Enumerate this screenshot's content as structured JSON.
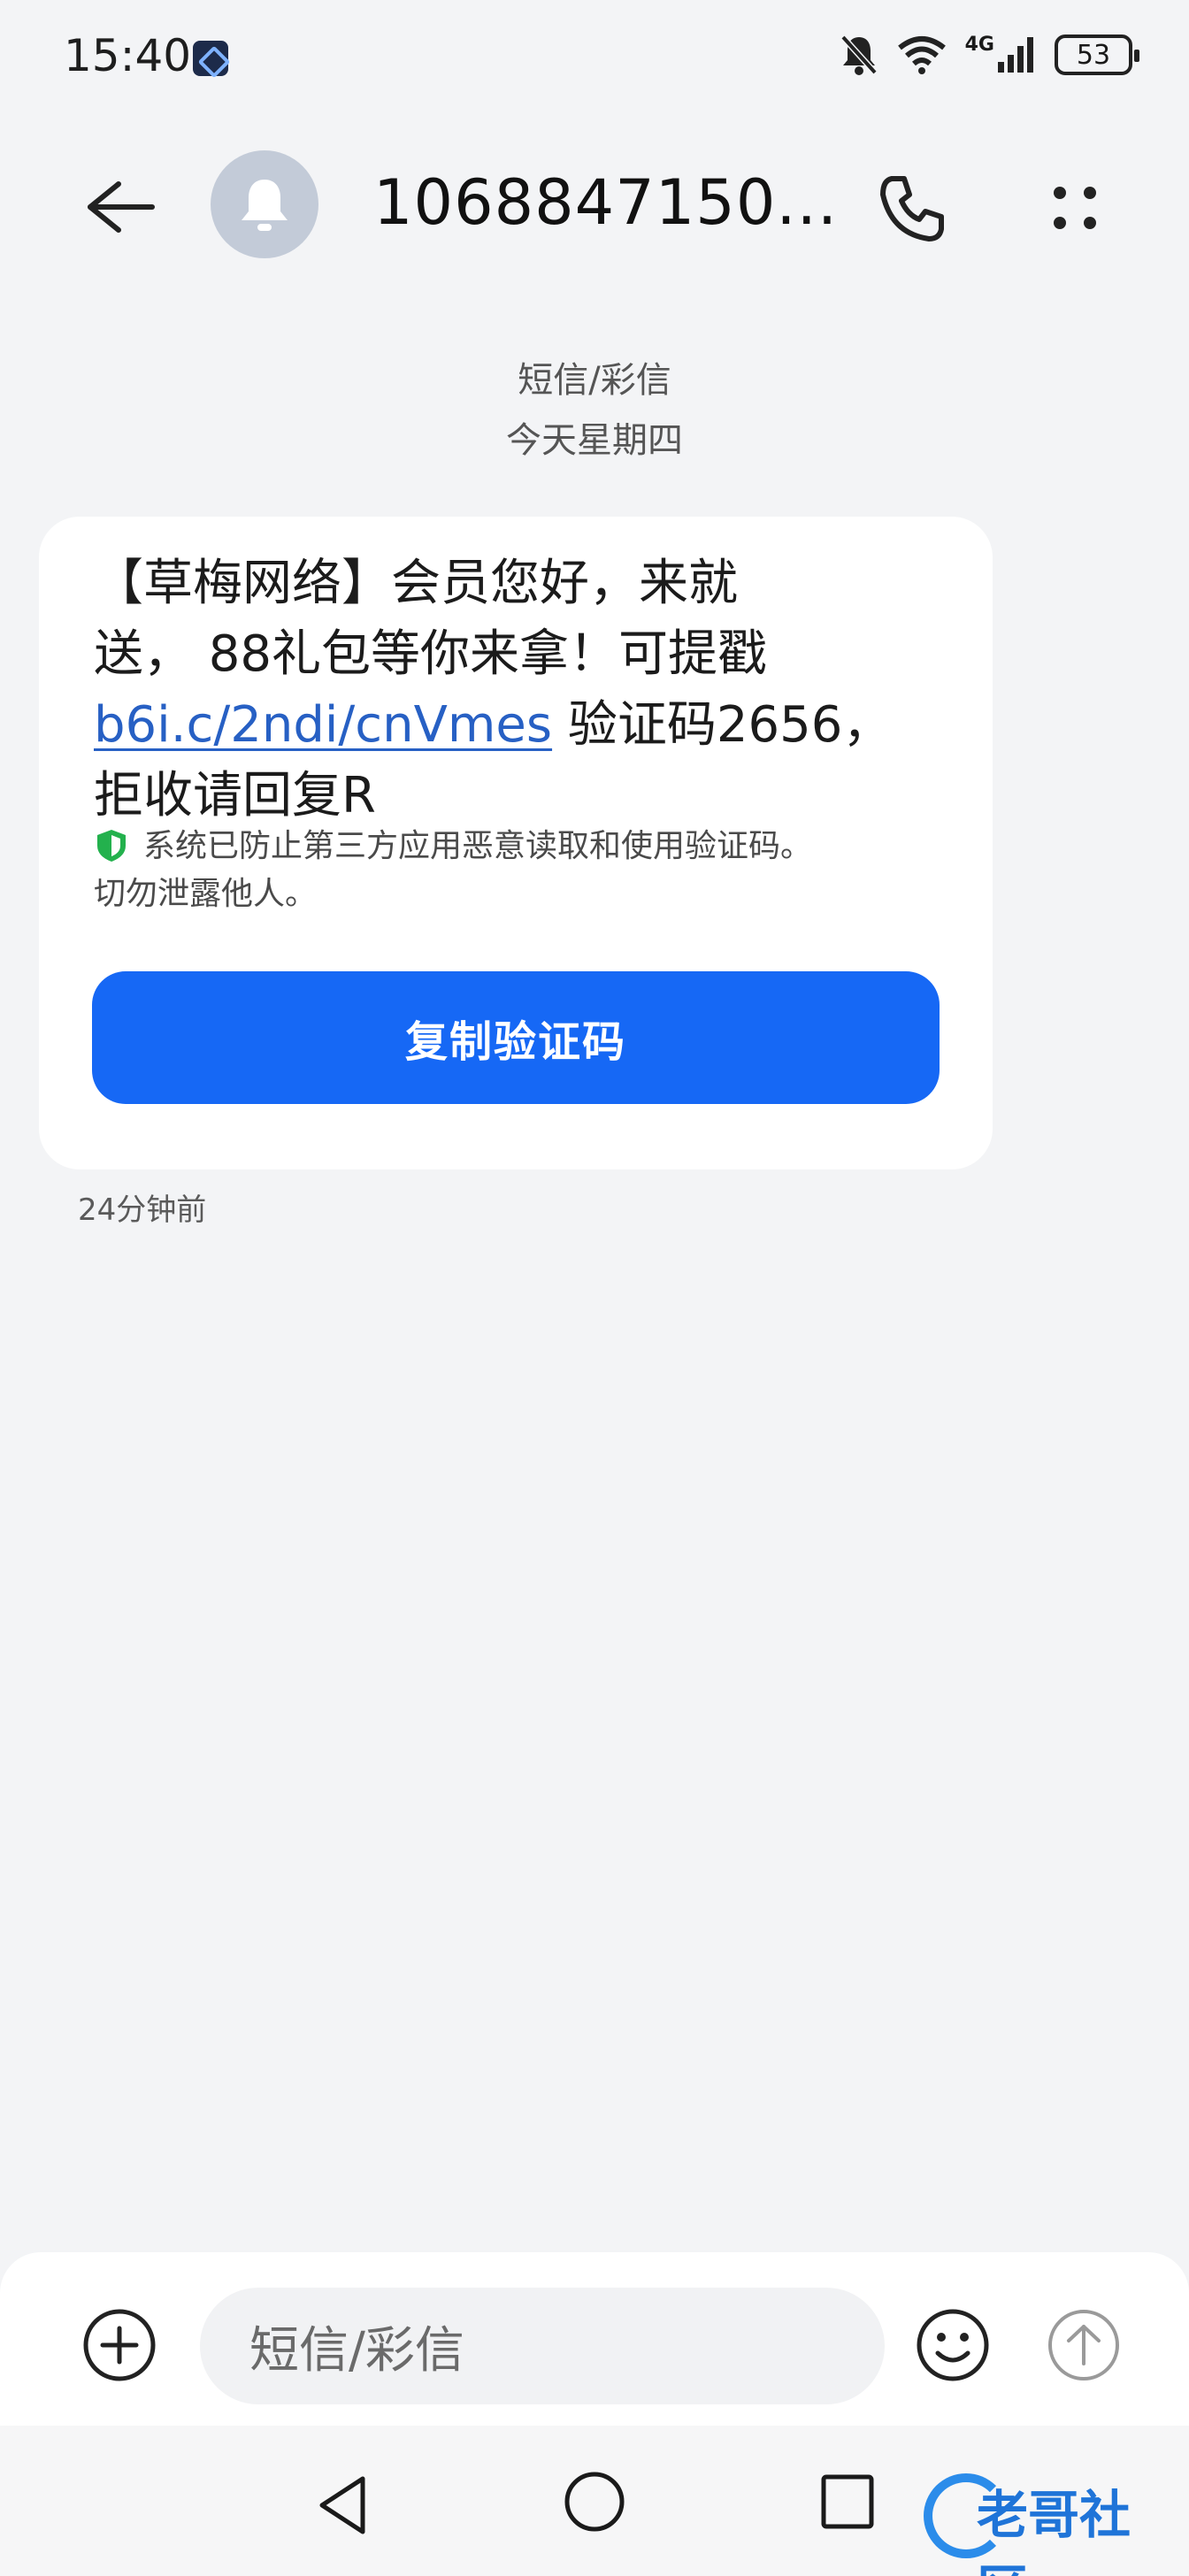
{
  "status_bar": {
    "time": "15:40",
    "network": "4G",
    "battery": "53",
    "icons": [
      "app-badge-icon",
      "mute-bell-icon",
      "wifi-icon",
      "signal-icon",
      "battery-icon"
    ]
  },
  "header": {
    "contact_name": "1068847150...",
    "avatar_icon": "bell-icon",
    "back_icon": "arrow-left-icon",
    "call_icon": "phone-icon",
    "more_icon": "more-dots-icon"
  },
  "meta": {
    "channel": "短信/彩信",
    "date": "今天星期四"
  },
  "message": {
    "text_line1": "【草梅网络】会员您好，来就",
    "text_line2": "送， 88礼包等你来拿！可提戳",
    "link": "b6i.c/2ndi/cnVmes",
    "text_after_link": " 验证码2656，",
    "text_line4": "拒收请回复R",
    "security_note_line1": "系统已防止第三方应用恶意读取和使用验证码。",
    "security_note_line2": "切勿泄露他人。",
    "copy_button": "复制验证码",
    "timestamp": "24分钟前"
  },
  "composer": {
    "placeholder": "短信/彩信",
    "icons": [
      "plus-circle-icon",
      "emoji-icon",
      "send-arrow-icon"
    ]
  },
  "watermark": {
    "text": "老哥社区"
  },
  "colors": {
    "background": "#f3f4f6",
    "bubble": "#ffffff",
    "primary_button": "#1668f5",
    "link": "#2760c4",
    "shield_green": "#23b14d",
    "avatar_bg": "#c3cbd8"
  }
}
